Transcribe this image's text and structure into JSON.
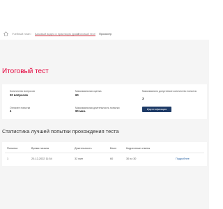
{
  "breadcrumb": {
    "items": [
      "Учебный план",
      "Базовый видео и практикум урока",
      "Итоговый тест",
      "Просмотр"
    ],
    "separator": "/"
  },
  "page": {
    "title": "Итоговый тест"
  },
  "info": {
    "questions_label": "Количество вопросов",
    "questions_value": "30 вопросов",
    "max_score_label": "Максимальная оценка",
    "max_score_value": "60",
    "max_attempts_label": "Максимально допустимое количество попыток",
    "max_attempts_value": "3",
    "attempts_label": "Оплачен попытки",
    "attempts_value": "4",
    "max_duration_label": "Максимальная длительность попытки",
    "max_duration_value": "90 мин.",
    "identify_button": "Идентификация"
  },
  "stats": {
    "title": "Статистика лучшей попытки прохождения теста",
    "columns": [
      "Попытка",
      "Время начала",
      "Длительность",
      "Балл",
      "Корректные ответы",
      ""
    ],
    "row": {
      "attempt": "1",
      "start": "20-12-2022 11:54",
      "duration": "32 мин",
      "score": "60",
      "correct": "30 из 30",
      "details": "Подробнее"
    }
  },
  "colors": {
    "accent_red": "#e4003a",
    "underline_red": "#cc1f2f",
    "button_navy": "#1d3a66",
    "link_blue": "#1e5a9e"
  }
}
